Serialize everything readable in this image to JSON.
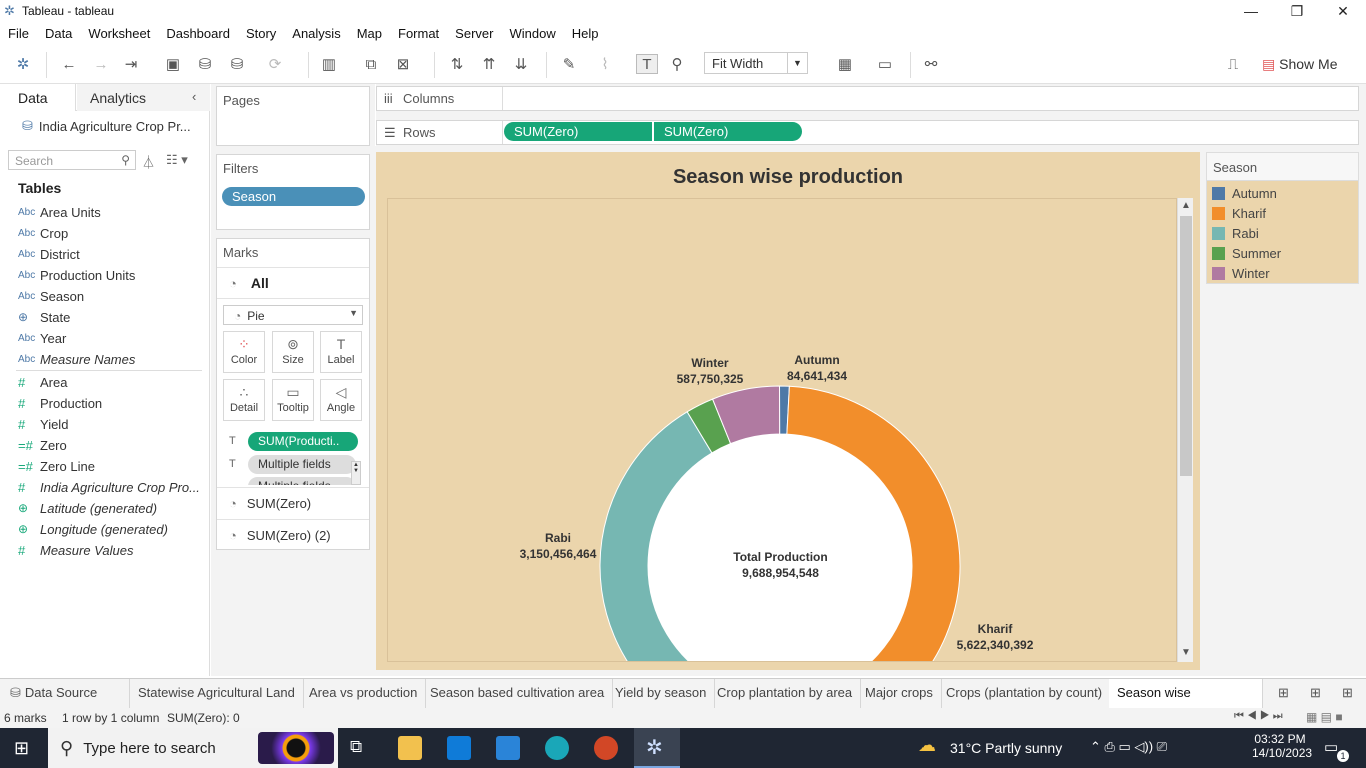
{
  "window": {
    "title": "Tableau - tableau"
  },
  "menu": [
    "File",
    "Data",
    "Worksheet",
    "Dashboard",
    "Story",
    "Analysis",
    "Map",
    "Format",
    "Server",
    "Window",
    "Help"
  ],
  "toolbar": {
    "fit": "Fit Width",
    "show_me": "Show Me"
  },
  "left_pane": {
    "tab_data": "Data",
    "tab_analytics": "Analytics",
    "datasource": "India Agriculture Crop Pr...",
    "search_placeholder": "Search",
    "tables_heading": "Tables",
    "dimension_badge": "Abc",
    "dimensions": [
      "Area Units",
      "Crop",
      "District",
      "Production Units",
      "Season",
      "State",
      "Year",
      "Measure Names"
    ],
    "measures": [
      "Area",
      "Production",
      "Yield",
      "Zero",
      "Zero Line",
      "India Agriculture Crop Pro...",
      "Latitude (generated)",
      "Longitude (generated)",
      "Measure Values"
    ]
  },
  "shelves": {
    "pages": "Pages",
    "columns": "Columns",
    "rows": "Rows",
    "row_pills": [
      "SUM(Zero)",
      "SUM(Zero)"
    ],
    "filters": "Filters",
    "filter_pills": [
      "Season"
    ]
  },
  "marks": {
    "title": "Marks",
    "all": "All",
    "type": "Pie",
    "buttons": [
      "Color",
      "Size",
      "Label",
      "Detail",
      "Tooltip",
      "Angle"
    ],
    "fields": [
      "SUM(Producti..",
      "Multiple fields",
      "Multiple fields"
    ],
    "sub_marks": [
      "SUM(Zero)",
      "SUM(Zero) (2)"
    ]
  },
  "chart_data": {
    "type": "pie",
    "title": "Season wise production",
    "center_label": "Total Production",
    "center_value": "9,688,954,548",
    "total": 9688954548,
    "slices": [
      {
        "name": "Autumn",
        "value": 84641434,
        "label": "84,641,434",
        "color": "#4e79a7"
      },
      {
        "name": "Kharif",
        "value": 5622340392,
        "label": "5,622,340,392",
        "color": "#f28e2b"
      },
      {
        "name": "Rabi",
        "value": 3150456464,
        "label": "3,150,456,464",
        "color": "#76b7b2"
      },
      {
        "name": "Summer",
        "value": 243765833,
        "label": "",
        "color": "#59a14f"
      },
      {
        "name": "Winter",
        "value": 587750325,
        "label": "587,750,325",
        "color": "#b07aa1"
      }
    ]
  },
  "legend": {
    "title": "Season",
    "items": [
      {
        "name": "Autumn",
        "color": "#4e79a7"
      },
      {
        "name": "Kharif",
        "color": "#f28e2b"
      },
      {
        "name": "Rabi",
        "color": "#76b7b2"
      },
      {
        "name": "Summer",
        "color": "#59a14f"
      },
      {
        "name": "Winter",
        "color": "#b07aa1"
      }
    ]
  },
  "sheet_tabs": [
    "Data Source",
    "Statewise Agricultural Land",
    "Area vs production",
    "Season based cultivation area",
    "Yield by season",
    "Crop plantation by area",
    "Major crops",
    "Crops (plantation by count)",
    "Season wise production"
  ],
  "status": {
    "marks": "6 marks",
    "grid": "1 row by 1 column",
    "sum": "SUM(Zero): 0"
  },
  "taskbar": {
    "search": "Type here to search",
    "weather": "31°C  Partly sunny",
    "time": "03:32 PM",
    "date": "14/10/2023",
    "notif": "1"
  }
}
